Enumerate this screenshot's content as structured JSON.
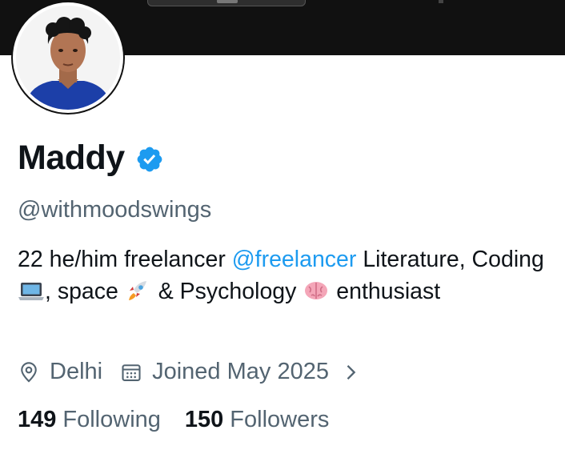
{
  "profile": {
    "name": "Maddy",
    "handle": "@withmoodswings",
    "verified_icon": "verified-badge-icon",
    "bio": {
      "part1": "22 he/him freelancer ",
      "mention": "@freelancer",
      "part2": "  Literature, Coding ",
      "part3": ", space ",
      "part4": " & Psychology ",
      "part5": " enthusiast"
    },
    "location": "Delhi",
    "joined": "Joined May 2025",
    "following_count": "149",
    "following_label": "Following",
    "followers_count": "150",
    "followers_label": "Followers"
  },
  "icons": {
    "location": "location-pin-icon",
    "calendar": "calendar-icon",
    "chevron": "chevron-right-icon",
    "laptop_emoji": "laptop-emoji-icon",
    "rocket_emoji": "rocket-emoji-icon",
    "brain_emoji": "brain-emoji-icon"
  },
  "colors": {
    "text_primary": "#0f1419",
    "text_secondary": "#536471",
    "accent": "#1d9bf0",
    "banner": "#111111"
  }
}
